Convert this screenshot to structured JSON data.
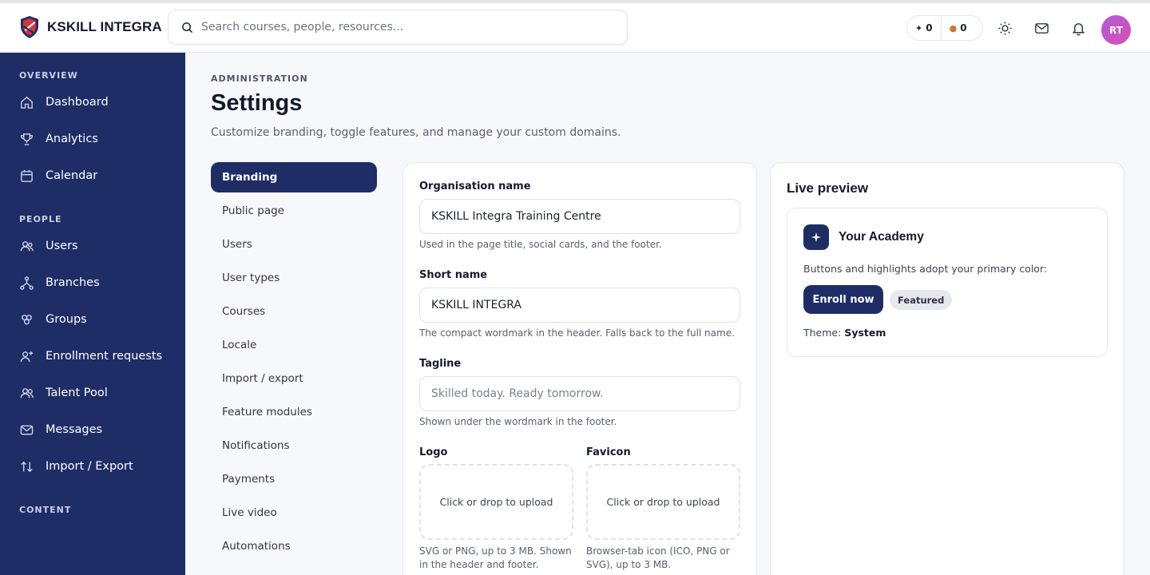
{
  "brand": {
    "name": "KSKILL INTEGRA"
  },
  "search": {
    "placeholder": "Search courses, people, resources..."
  },
  "stats": {
    "sparks": "0",
    "streak": "0"
  },
  "user": {
    "initials": "RT"
  },
  "colors": {
    "sidebar": "#1f2d66",
    "accent": "#1f2d66",
    "avatar": "#c456c8"
  },
  "sidebar": {
    "sections": [
      {
        "title": "OVERVIEW"
      },
      {
        "title": "PEOPLE"
      },
      {
        "title": "CONTENT"
      }
    ],
    "items": [
      {
        "label": "Dashboard",
        "icon": "home-icon"
      },
      {
        "label": "Analytics",
        "icon": "trophy-icon"
      },
      {
        "label": "Calendar",
        "icon": "calendar-icon"
      },
      {
        "label": "Users",
        "icon": "users-icon"
      },
      {
        "label": "Branches",
        "icon": "branches-icon"
      },
      {
        "label": "Groups",
        "icon": "groups-icon"
      },
      {
        "label": "Enrollment requests",
        "icon": "user-plus-icon"
      },
      {
        "label": "Talent Pool",
        "icon": "talent-icon"
      },
      {
        "label": "Messages",
        "icon": "mail-icon"
      },
      {
        "label": "Import / Export",
        "icon": "import-export-icon"
      }
    ]
  },
  "page": {
    "eyebrow": "ADMINISTRATION",
    "title": "Settings",
    "subtitle": "Customize branding, toggle features, and manage your custom domains."
  },
  "subnav": [
    {
      "label": "Branding",
      "active": true
    },
    {
      "label": "Public page"
    },
    {
      "label": "Users"
    },
    {
      "label": "User types"
    },
    {
      "label": "Courses"
    },
    {
      "label": "Locale"
    },
    {
      "label": "Import / export"
    },
    {
      "label": "Feature modules"
    },
    {
      "label": "Notifications"
    },
    {
      "label": "Payments"
    },
    {
      "label": "Live video"
    },
    {
      "label": "Automations"
    }
  ],
  "form": {
    "org_name": {
      "label": "Organisation name",
      "value": "KSKILL Integra Training Centre",
      "help": "Used in the page title, social cards, and the footer."
    },
    "short_name": {
      "label": "Short name",
      "value": "KSKILL INTEGRA",
      "help": "The compact wordmark in the header. Falls back to the full name."
    },
    "tagline": {
      "label": "Tagline",
      "value": "",
      "placeholder": "Skilled today. Ready tomorrow.",
      "help": "Shown under the wordmark in the footer."
    },
    "logo": {
      "label": "Logo",
      "drop": "Click or drop to upload",
      "help": "SVG or PNG, up to 3 MB. Shown in the header and footer."
    },
    "favicon": {
      "label": "Favicon",
      "drop": "Click or drop to upload",
      "help": "Browser-tab icon (ICO, PNG or SVG), up to 3 MB."
    }
  },
  "preview": {
    "title": "Live preview",
    "academy": "Your Academy",
    "desc": "Buttons and highlights adopt your primary color:",
    "button": "Enroll now",
    "badge": "Featured",
    "theme_label": "Theme:",
    "theme_value": "System"
  }
}
